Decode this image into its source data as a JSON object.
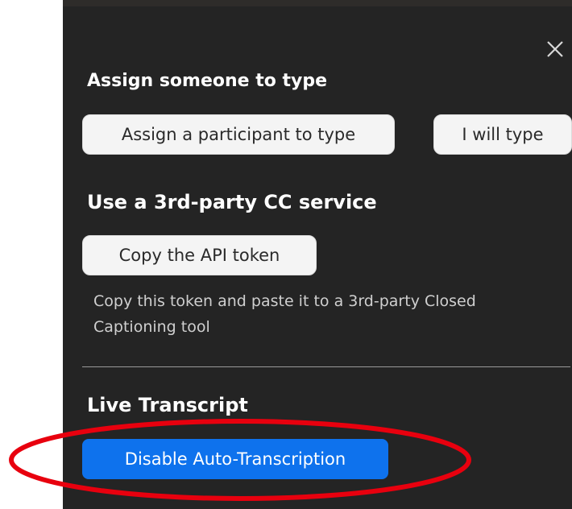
{
  "panel": {
    "close_icon": "close-icon",
    "assign_section": {
      "heading": "Assign someone to type",
      "assign_participant_label": "Assign a participant to type",
      "i_will_type_label": "I will type"
    },
    "third_party_section": {
      "heading": "Use a 3rd-party CC service",
      "copy_token_label": "Copy the API token",
      "description": "Copy this token and paste it to a 3rd-party Closed Captioning tool"
    },
    "live_transcript_section": {
      "heading": "Live Transcript",
      "disable_label": "Disable Auto-Transcription"
    }
  },
  "colors": {
    "panel_bg": "#242424",
    "primary_button": "#0e72ed",
    "annotation": "#e8000e"
  }
}
